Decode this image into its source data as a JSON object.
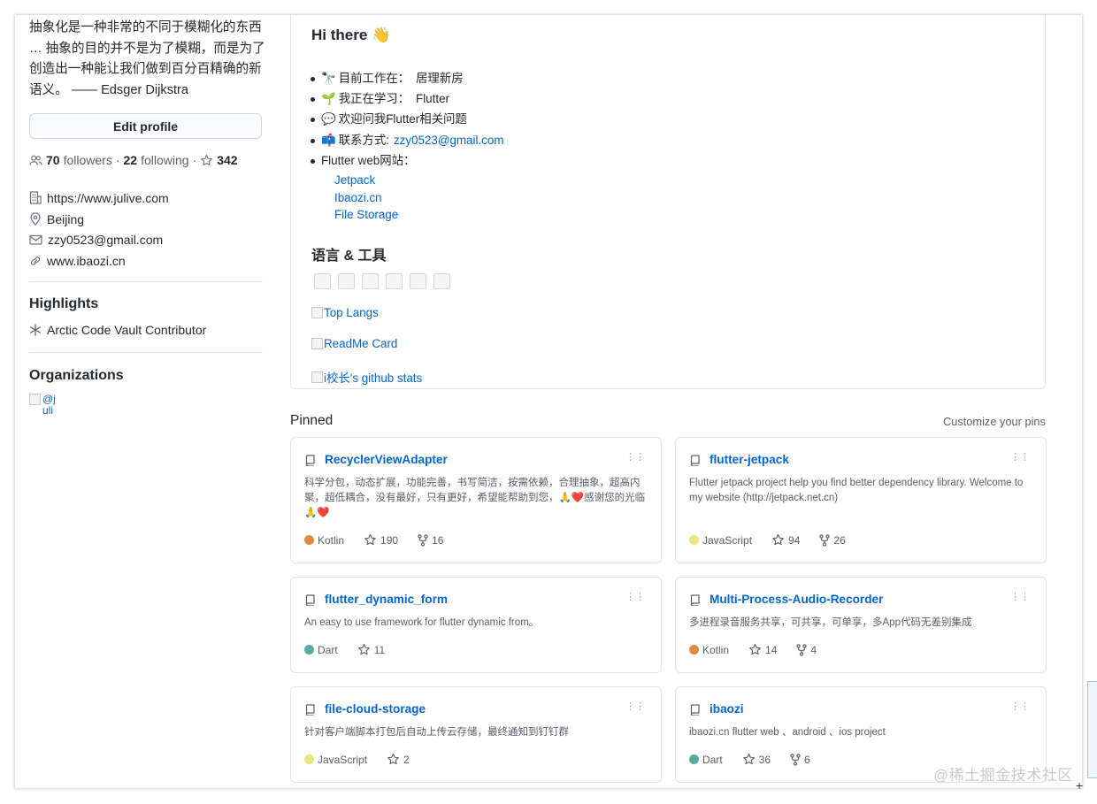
{
  "sidebar": {
    "bio": "抽象化是一种非常的不同于模糊化的东西 … 抽象的目的并不是为了模糊，而是为了创造出一种能让我们做到百分百精确的新语义。 —— Edsger Dijkstra",
    "edit_profile": "Edit profile",
    "followers_count": "70",
    "followers_label": "followers",
    "sep1": "·",
    "following_count": "22",
    "following_label": "following",
    "sep2": "·",
    "stars_count": "342",
    "website": "https://www.julive.com",
    "location": "Beijing",
    "email": "zzy0523@gmail.com",
    "blog": "www.ibaozi.cn",
    "highlights_title": "Highlights",
    "highlight_item": "Arctic Code Vault Contributor",
    "organizations_title": "Organizations",
    "org_alt": "@juli"
  },
  "readme": {
    "greeting": "Hi there 👋",
    "items": [
      {
        "emoji": "🔭",
        "label": "目前工作在：",
        "value": "居理新房"
      },
      {
        "emoji": "🌱",
        "label": "我正在学习：",
        "value": "Flutter"
      },
      {
        "emoji": "💬",
        "label": "欢迎问我Flutter相关问题",
        "value": ""
      },
      {
        "emoji": "📫",
        "label": "联系方式:",
        "value": "zzy0523@gmail.com"
      },
      {
        "emoji": "",
        "label": "Flutter web网站：",
        "value": ""
      }
    ],
    "sites": [
      "Jetpack",
      "Ibaozi.cn",
      "File Storage"
    ],
    "lang_title": "语言 & 工具",
    "img_links": [
      "Top Langs",
      "ReadMe Card",
      "i校长's github stats"
    ]
  },
  "pinned": {
    "title": "Pinned",
    "customize": "Customize your pins",
    "cards": [
      {
        "name": "RecyclerViewAdapter",
        "desc": "科学分包，动态扩展，功能完善，书写简洁，按需依赖，合理抽象，超高内聚，超低耦合，没有最好，只有更好，希望能帮助到您，🙏❤️感谢您的光临🙏❤️",
        "lang": "Kotlin",
        "lang_color": "#e18b3f",
        "stars": "190",
        "forks": "16"
      },
      {
        "name": "flutter-jetpack",
        "desc": "Flutter jetpack project help you find better dependency library. Welcome to my website (http://jetpack.net.cn)",
        "lang": "JavaScript",
        "lang_color": "#ebe77a",
        "stars": "94",
        "forks": "26"
      },
      {
        "name": "flutter_dynamic_form",
        "desc": "An easy to use framework for flutter dynamic from。",
        "lang": "Dart",
        "lang_color": "#5aab9f",
        "stars": "11",
        "forks": ""
      },
      {
        "name": "Multi-Process-Audio-Recorder",
        "desc": "多进程录音服务共享，可共享，可单享，多App代码无差别集成",
        "lang": "Kotlin",
        "lang_color": "#e18b3f",
        "stars": "14",
        "forks": "4"
      },
      {
        "name": "file-cloud-storage",
        "desc": "针对客户端脚本打包后自动上传云存储，最终通知到钉钉群",
        "lang": "JavaScript",
        "lang_color": "#ebe77a",
        "stars": "2",
        "forks": ""
      },
      {
        "name": "ibaozi",
        "desc": "ibaozi.cn flutter web 、android 、ios project",
        "lang": "Dart",
        "lang_color": "#5aab9f",
        "stars": "36",
        "forks": "6"
      }
    ]
  },
  "watermark": "@稀土掘金技术社区"
}
